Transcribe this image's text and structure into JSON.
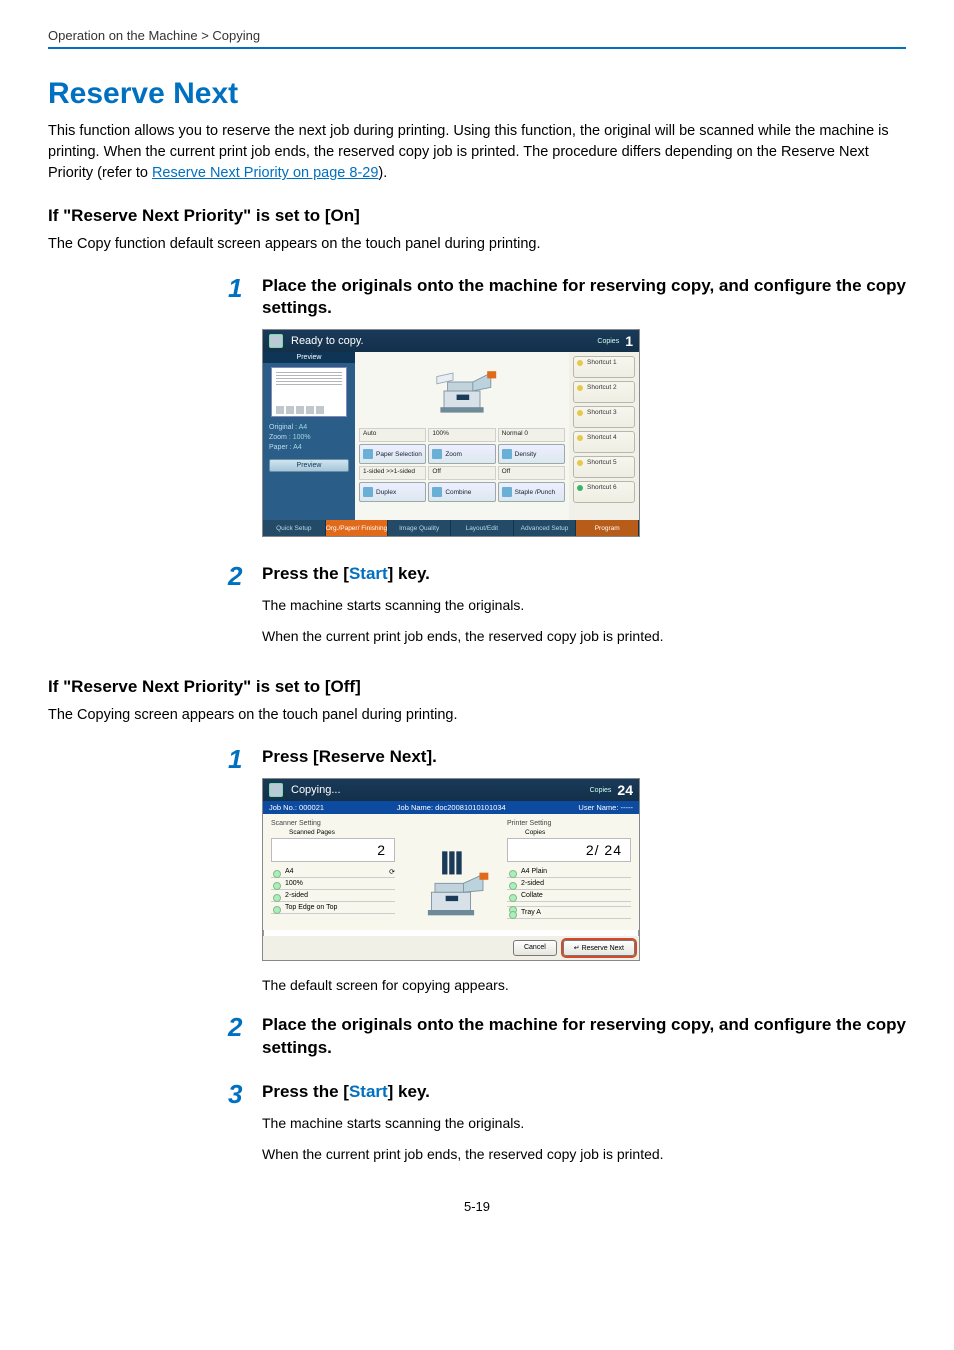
{
  "breadcrumb": "Operation on the Machine > Copying",
  "h1": "Reserve Next",
  "intro_pre": "This function allows you to reserve the next job during printing. Using this function, the original will be scanned while the machine is printing. When the current print job ends, the reserved copy job is printed. The procedure differs depending on the Reserve Next Priority (refer to ",
  "intro_link": "Reserve Next Priority on page 8-29",
  "intro_post": ").",
  "sec_on_title": "If \"Reserve Next Priority\" is set to [On]",
  "sec_on_body": "The Copy function default screen appears on the touch panel during printing.",
  "sec_off_title": "If \"Reserve Next Priority\" is set to [Off]",
  "sec_off_body": "The Copying screen appears on the touch panel during printing.",
  "on_steps": {
    "s1": {
      "num": "1",
      "title": "Place the originals onto the machine for reserving copy, and configure the copy settings."
    },
    "s2": {
      "num": "2",
      "title_pre": "Press the [",
      "title_key": "Start",
      "title_post": "] key.",
      "line1": "The machine starts scanning the originals.",
      "line2": "When the current print job ends, the reserved copy job is printed."
    }
  },
  "off_steps": {
    "s1": {
      "num": "1",
      "title": "Press [Reserve Next].",
      "after": "The default screen for copying appears."
    },
    "s2": {
      "num": "2",
      "title": "Place the originals onto the machine for reserving copy, and configure the copy settings."
    },
    "s3": {
      "num": "3",
      "title_pre": "Press the [",
      "title_key": "Start",
      "title_post": "] key.",
      "line1": "The machine starts scanning the originals.",
      "line2": "When the current print job ends, the reserved copy job is printed."
    }
  },
  "panel_ready": {
    "title": "Ready to copy.",
    "copies_label": "Copies",
    "copies_value": "1",
    "left": {
      "preview_label": "Preview",
      "original_k": "Original",
      "original_v": ": A4",
      "zoom_k": "Zoom",
      "zoom_v": ": 100%",
      "paper_k": "Paper",
      "paper_v": ": A4",
      "preview_btn": "Preview"
    },
    "grid": {
      "r1": [
        "Auto",
        "100%",
        "Normal 0"
      ],
      "btns1": [
        "Paper Selection",
        "Zoom",
        "Density"
      ],
      "r2": [
        "1-sided >>1-sided",
        "Off",
        "Off"
      ],
      "btns2": [
        "Duplex",
        "Combine",
        "Staple /Punch"
      ]
    },
    "shortcuts": [
      "Shortcut 1",
      "Shortcut 2",
      "Shortcut 3",
      "Shortcut 4",
      "Shortcut 5",
      "Shortcut 6"
    ],
    "tabs": [
      "Quick Setup",
      "Org./Paper/ Finishing",
      "Image Quality",
      "Layout/Edit",
      "Advanced Setup",
      "Program"
    ]
  },
  "panel_copying": {
    "title": "Copying...",
    "copies_label": "Copies",
    "copies_value": "24",
    "bar": {
      "jobno_k": "Job No.:",
      "jobno_v": "000021",
      "jobname_k": "Job Name:",
      "jobname_v": "doc20081010101034",
      "user_k": "User Name:",
      "user_v": "-----"
    },
    "left": {
      "hdr": "Scanner Setting",
      "pages_lbl": "Scanned Pages",
      "pages_val": "2",
      "list": [
        "A4",
        "100%",
        "2-sided",
        "Top Edge on Top"
      ]
    },
    "right": {
      "hdr": "Printer Setting",
      "copies_lbl": "Copies",
      "copies_val": "2/   24",
      "list": [
        "A4            Plain",
        "2-sided",
        "Collate",
        "",
        "Tray A"
      ]
    },
    "buttons": {
      "cancel": "Cancel",
      "reserve": "Reserve Next"
    }
  },
  "page_number": "5-19"
}
